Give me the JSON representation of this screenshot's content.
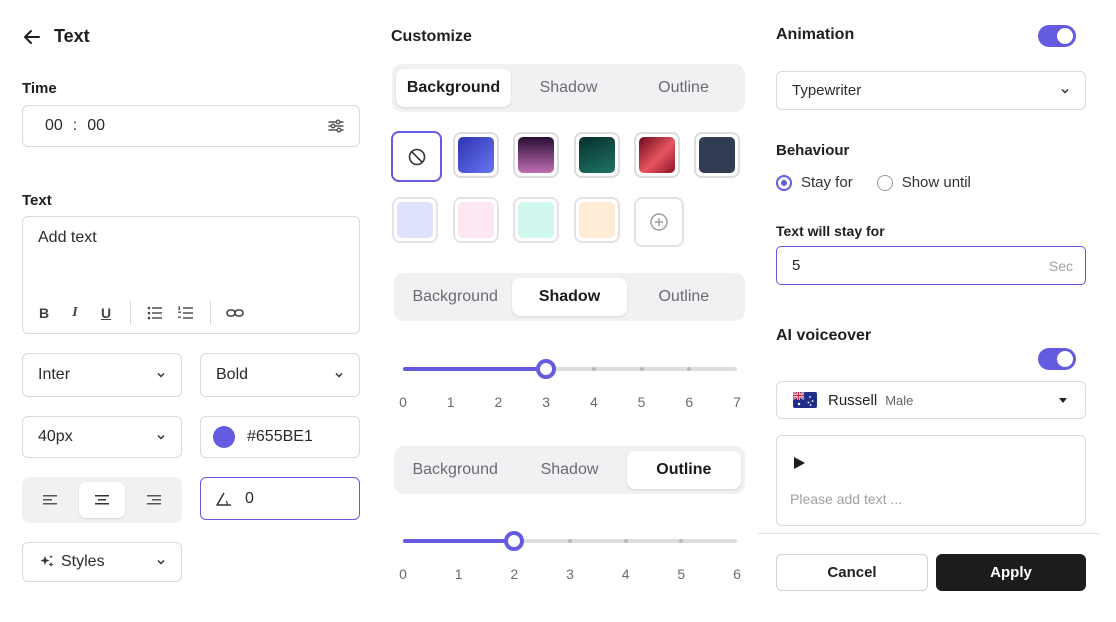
{
  "header": {
    "back_label": "Text"
  },
  "time": {
    "label": "Time",
    "hours": "00",
    "sep": ":",
    "minutes": "00"
  },
  "text_section": {
    "label": "Text",
    "placeholder": "Add text",
    "toolbar": {
      "bold": "B",
      "italic": "I",
      "underline": "U"
    }
  },
  "font": {
    "family": "Inter",
    "weight": "Bold",
    "size": "40px",
    "color_hex": "#655BE1",
    "rotation": "0"
  },
  "styles_label": "Styles",
  "customize": {
    "title": "Customize",
    "background_tabs": [
      "Background",
      "Shadow",
      "Outline"
    ],
    "background_active": 0,
    "swatches": [
      {
        "name": "none"
      },
      {
        "name": "blue-gradient",
        "from": "#3b46c9",
        "to": "#5c6ff0"
      },
      {
        "name": "purple-gradient",
        "from": "#3a1340",
        "to": "#c274b7"
      },
      {
        "name": "teal-gradient",
        "from": "#0b3634",
        "to": "#1d7063"
      },
      {
        "name": "red-gradient",
        "from": "#7a1020",
        "to": "#e0505a"
      },
      {
        "name": "slate",
        "from": "#323c52",
        "to": "#323c52"
      },
      {
        "name": "lavender",
        "from": "#dfe2fb",
        "to": "#dfe2fb"
      },
      {
        "name": "pink",
        "from": "#fbe6f1",
        "to": "#fbe6f1"
      },
      {
        "name": "mint",
        "from": "#d1f8ee",
        "to": "#d1f8ee"
      },
      {
        "name": "peach",
        "from": "#ffecd6",
        "to": "#ffecd6"
      },
      {
        "name": "add"
      }
    ],
    "shadow_tabs": [
      "Background",
      "Shadow",
      "Outline"
    ],
    "shadow_active": 1,
    "shadow_slider": {
      "ticks": [
        "0",
        "1",
        "2",
        "3",
        "4",
        "5",
        "6",
        "7"
      ],
      "value": 3,
      "max": 7
    },
    "outline_tabs": [
      "Background",
      "Shadow",
      "Outline"
    ],
    "outline_active": 2,
    "outline_slider": {
      "ticks": [
        "0",
        "1",
        "2",
        "3",
        "4",
        "5",
        "6"
      ],
      "value": 2,
      "max": 6
    }
  },
  "animation": {
    "title": "Animation",
    "enabled": true,
    "type": "Typewriter"
  },
  "behaviour": {
    "title": "Behaviour",
    "options": [
      "Stay for",
      "Show until"
    ],
    "selected": 0,
    "stay_label": "Text will stay for",
    "stay_value": "5",
    "stay_unit": "Sec"
  },
  "voiceover": {
    "title": "AI voiceover",
    "enabled": true,
    "voice_name": "Russell",
    "voice_gender": "Male",
    "text_placeholder": "Please add text ..."
  },
  "footer": {
    "cancel": "Cancel",
    "apply": "Apply"
  },
  "colors": {
    "accent": "#655BE1",
    "dark": "#1c1c1c"
  }
}
